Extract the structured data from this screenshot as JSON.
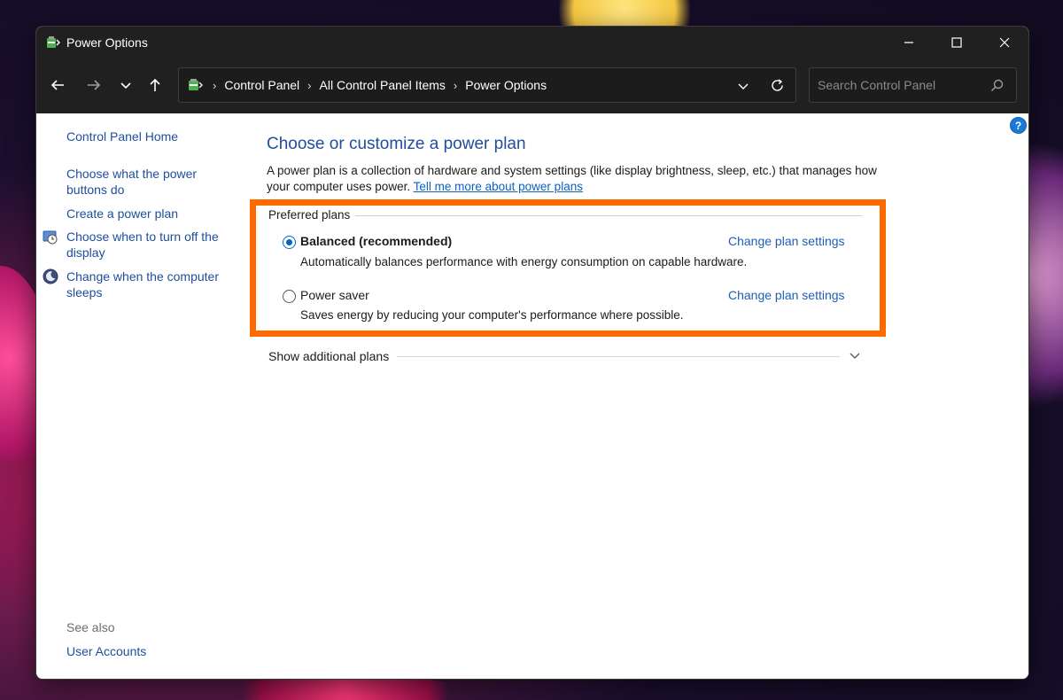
{
  "window": {
    "title": "Power Options"
  },
  "nav": {
    "breadcrumbs": [
      "Control Panel",
      "All Control Panel Items",
      "Power Options"
    ],
    "search_placeholder": "Search Control Panel"
  },
  "sidebar": {
    "home": "Control Panel Home",
    "links": [
      "Choose what the power buttons do",
      "Create a power plan",
      "Choose when to turn off the display",
      "Change when the computer sleeps"
    ],
    "see_also_label": "See also",
    "see_also_links": [
      "User Accounts"
    ]
  },
  "main": {
    "heading": "Choose or customize a power plan",
    "description": "A power plan is a collection of hardware and system settings (like display brightness, sleep, etc.) that manages how your computer uses power.",
    "learn_more": "Tell me more about power plans",
    "group_label": "Preferred plans",
    "plans": [
      {
        "name": "Balanced (recommended)",
        "description": "Automatically balances performance with energy consumption on capable hardware.",
        "selected": true,
        "change_link": "Change plan settings"
      },
      {
        "name": "Power saver",
        "description": "Saves energy by reducing your computer's performance where possible.",
        "selected": false,
        "change_link": "Change plan settings"
      }
    ],
    "show_additional": "Show additional plans"
  },
  "colors": {
    "highlight_box": "#ff6a00",
    "link_blue": "#1e4e9c",
    "titlebar_bg": "#202020"
  },
  "icons": {
    "app": "power-options-icon",
    "help": "help-icon"
  }
}
